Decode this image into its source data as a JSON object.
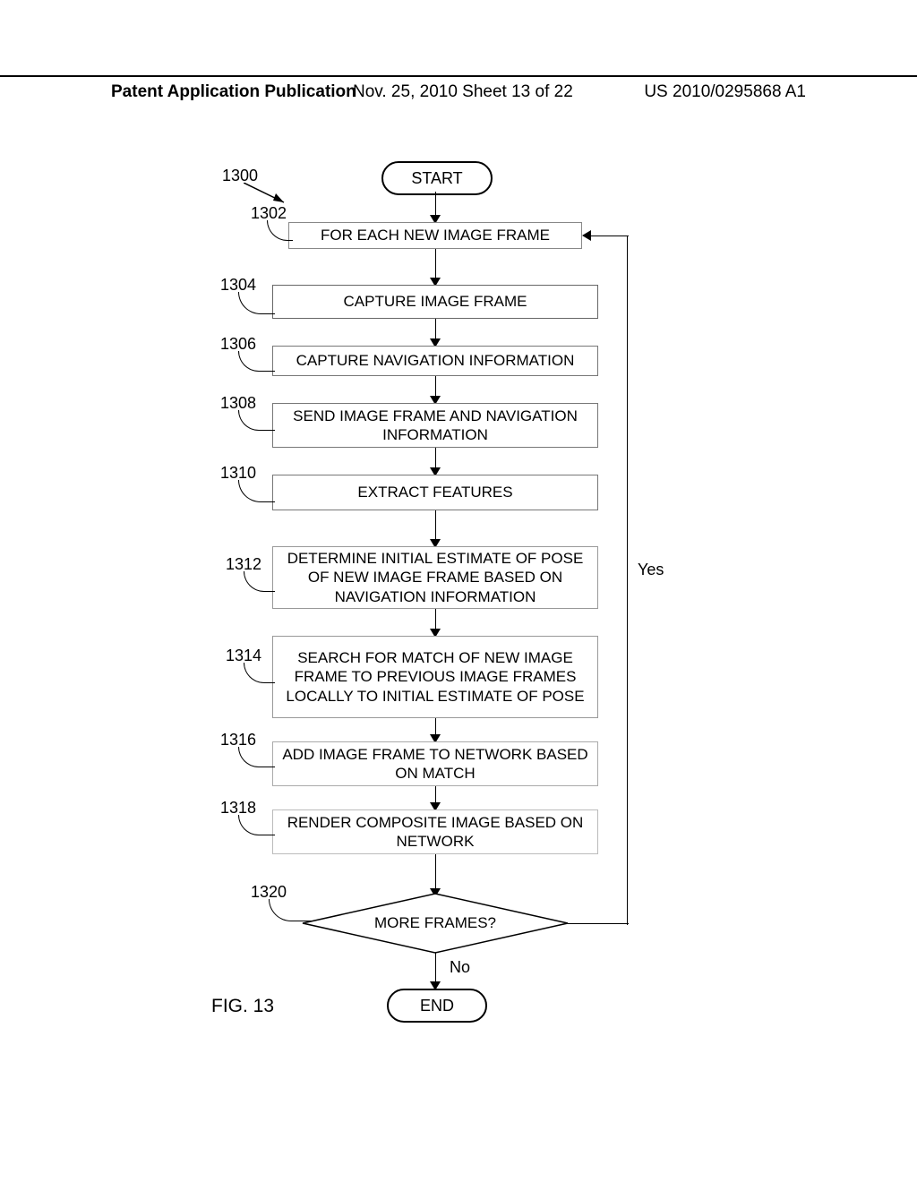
{
  "header": {
    "left": "Patent Application Publication",
    "mid": "Nov. 25, 2010  Sheet 13 of 22",
    "right": "US 2010/0295868 A1"
  },
  "terminators": {
    "start": "START",
    "end": "END"
  },
  "refs": {
    "r1300": "1300",
    "r1302": "1302",
    "r1304": "1304",
    "r1306": "1306",
    "r1308": "1308",
    "r1310": "1310",
    "r1312": "1312",
    "r1314": "1314",
    "r1316": "1316",
    "r1318": "1318",
    "r1320": "1320"
  },
  "steps": {
    "s1302": "FOR EACH NEW IMAGE FRAME",
    "s1304": "CAPTURE IMAGE FRAME",
    "s1306": "CAPTURE NAVIGATION INFORMATION",
    "s1308": "SEND IMAGE FRAME AND NAVIGATION INFORMATION",
    "s1310": "EXTRACT FEATURES",
    "s1312": "DETERMINE INITIAL ESTIMATE OF POSE OF NEW IMAGE FRAME BASED ON NAVIGATION INFORMATION",
    "s1314": "SEARCH FOR MATCH OF NEW IMAGE FRAME TO PREVIOUS IMAGE FRAMES LOCALLY TO INITIAL ESTIMATE OF POSE",
    "s1316": "ADD IMAGE FRAME TO NETWORK BASED ON MATCH",
    "s1318": "RENDER COMPOSITE IMAGE BASED ON NETWORK"
  },
  "decision": {
    "q1320": "MORE FRAMES?",
    "yes": "Yes",
    "no": "No"
  },
  "figure": "FIG. 13"
}
